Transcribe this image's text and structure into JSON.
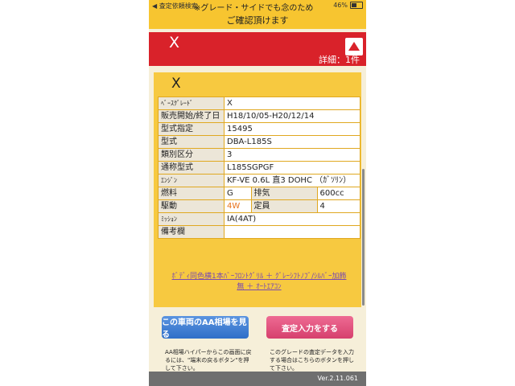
{
  "status_bar": {
    "left_text": "◀ 査定依頼検索",
    "center_text": "※グレード・サイドでも念のため",
    "battery": "46%"
  },
  "notice_line2": "ご確認頂けます",
  "header": {
    "title": "X",
    "detail_count": "詳細：1件"
  },
  "card": {
    "title": "X",
    "rows": [
      {
        "label": "ﾍﾞｰｽｸﾞﾚｰﾄﾞ",
        "value": "X"
      },
      {
        "label": "販売開始/終了日",
        "value": "H18/10/05-H20/12/14"
      },
      {
        "label": "型式指定",
        "value": "15495"
      },
      {
        "label": "型式",
        "value": "DBA-L185S"
      },
      {
        "label": "類別区分",
        "value": "3"
      },
      {
        "label": "通称型式",
        "value": "L185SGPGF"
      },
      {
        "label": "ｴﾝｼﾞﾝ",
        "value": "KF-VE 0.6L 直3 DOHC （ｶﾞｿﾘﾝ）"
      }
    ],
    "fuel": {
      "label": "燃料",
      "value": "G",
      "label2": "排気",
      "value2": "600cc"
    },
    "drive": {
      "label": "駆動",
      "value": "4W",
      "label2": "定員",
      "value2": "4"
    },
    "mission": {
      "label": "ﾐｯｼｮﾝ",
      "value": "IA(4AT)"
    },
    "remarks": {
      "label": "備考欄",
      "value": ""
    },
    "options_line1": "ﾎﾞﾃﾞｨ同色横1本ﾊﾞｰﾌﾛﾝﾄｸﾞﾘﾙ ＋ ｸﾞﾚｰｼﾌﾄﾉﾌﾞ/ｼﾙﾊﾞｰ加飾",
    "options_line2": "無 ＋ ｵｰﾄｴｱｺﾝ"
  },
  "buttons": {
    "aa_market": "この車両のAA相場を見る",
    "appraise": "査定入力をする"
  },
  "notes": {
    "left": "AA相場ハイパーからこの画面に戻るには、\"端末の戻るボタン\"を押して下さい。",
    "right": "このグレードの査定データを入力する場合はこちらのボタンを押して下さい。"
  },
  "version": "Ver.2.11.061",
  "colors": {
    "header_red": "#d9222a",
    "card_yellow": "#f7c940",
    "status_yellow": "#f7c530",
    "drive_orange": "#e8731a",
    "button_blue": "#2f6fc8",
    "button_pink": "#d6406d"
  }
}
